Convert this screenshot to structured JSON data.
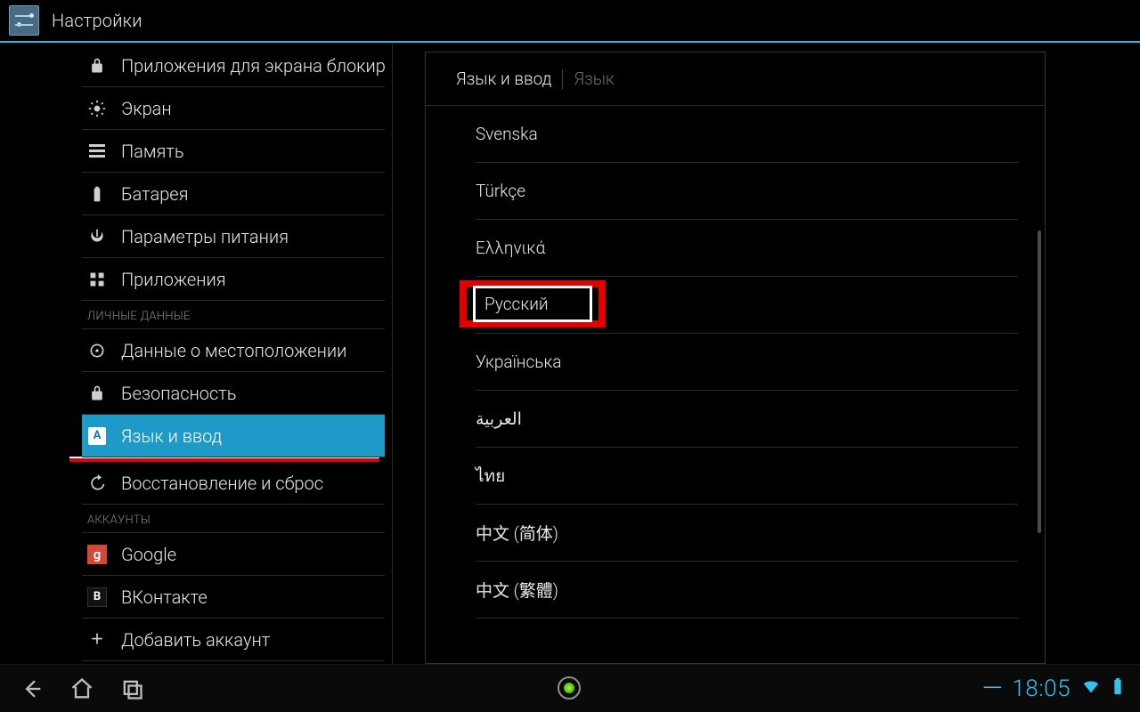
{
  "actionbar": {
    "title": "Настройки"
  },
  "sidebar": {
    "items": [
      {
        "icon": "lock",
        "label": "Приложения для экрана блокировки"
      },
      {
        "icon": "brightness",
        "label": "Экран"
      },
      {
        "icon": "storage",
        "label": "Память"
      },
      {
        "icon": "battery",
        "label": "Батарея"
      },
      {
        "icon": "power",
        "label": "Параметры питания"
      },
      {
        "icon": "apps",
        "label": "Приложения"
      }
    ],
    "section_personal": "ЛИЧНЫЕ ДАННЫЕ",
    "items_personal": [
      {
        "icon": "target",
        "label": "Данные о местоположении"
      },
      {
        "icon": "lock",
        "label": "Безопасность"
      },
      {
        "icon": "language",
        "label": "Язык и ввод",
        "selected": true
      },
      {
        "icon": "restore",
        "label": "Восстановление и сброс"
      }
    ],
    "section_accounts": "АККАУНТЫ",
    "items_accounts": [
      {
        "icon": "google",
        "label": "Google"
      },
      {
        "icon": "vk",
        "label": "ВКонтакте"
      },
      {
        "icon": "plus",
        "label": "Добавить аккаунт"
      }
    ]
  },
  "detail": {
    "title": "Язык и ввод",
    "subtitle": "Язык",
    "languages": [
      "Svenska",
      "Türkçe",
      "Ελληνικά",
      "Русский",
      "Українська",
      "العربية",
      "ไทย",
      "中文 (简体)",
      "中文 (繁體)"
    ],
    "highlighted_index": 3
  },
  "navbar": {
    "time": "18:05"
  }
}
